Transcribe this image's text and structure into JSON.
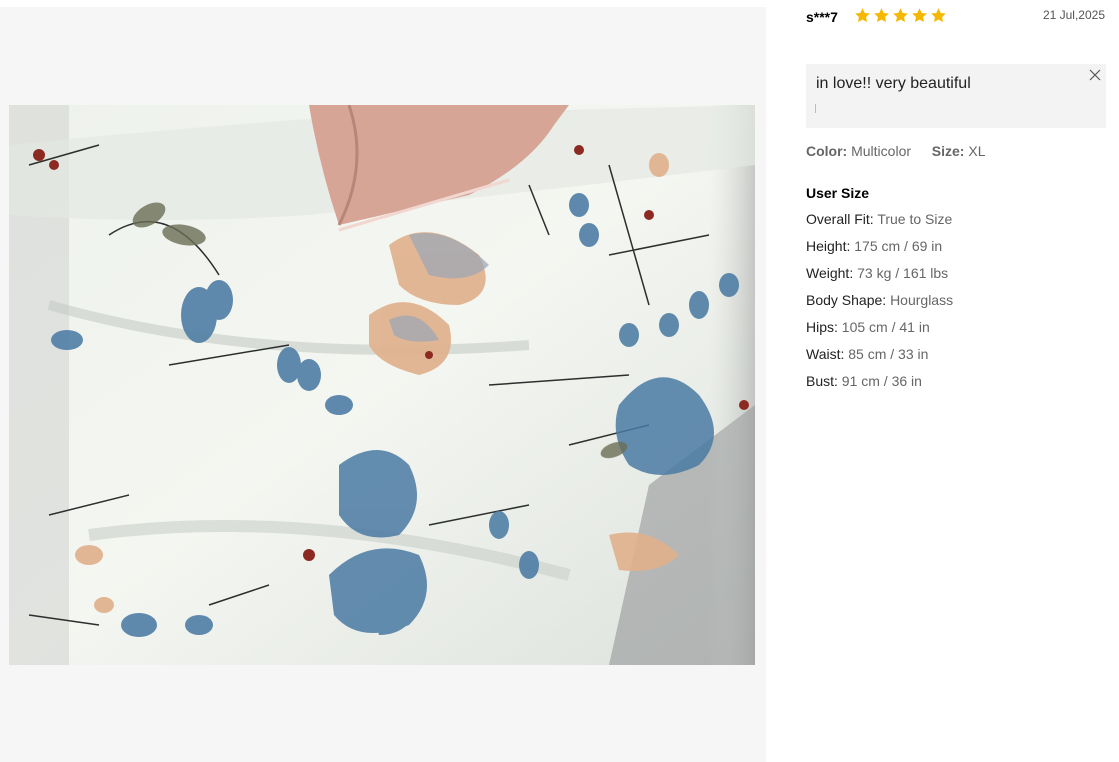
{
  "review": {
    "username": "s***7",
    "rating": 5,
    "date": "21 Jul,2025",
    "comment": "in love!! very beautiful",
    "attributes": {
      "color_label": "Color:",
      "color_value": "Multicolor",
      "size_label": "Size:",
      "size_value": "XL"
    },
    "user_size": {
      "title": "User Size",
      "rows": [
        {
          "label": "Overall Fit:",
          "value": "True to Size"
        },
        {
          "label": "Height:",
          "value": "175 cm / 69 in"
        },
        {
          "label": "Weight:",
          "value": "73 kg / 161 lbs"
        },
        {
          "label": "Body Shape:",
          "value": "Hourglass"
        },
        {
          "label": "Hips:",
          "value": "105 cm / 41 in"
        },
        {
          "label": "Waist:",
          "value": "85 cm / 33 in"
        },
        {
          "label": "Bust:",
          "value": "91 cm / 36 in"
        }
      ]
    }
  },
  "colors": {
    "star": "#f5b800",
    "panel_bg": "#f6f6f6",
    "comment_bg": "#f3f3f3"
  },
  "icons": {
    "star": "star-icon",
    "close": "close-icon"
  }
}
